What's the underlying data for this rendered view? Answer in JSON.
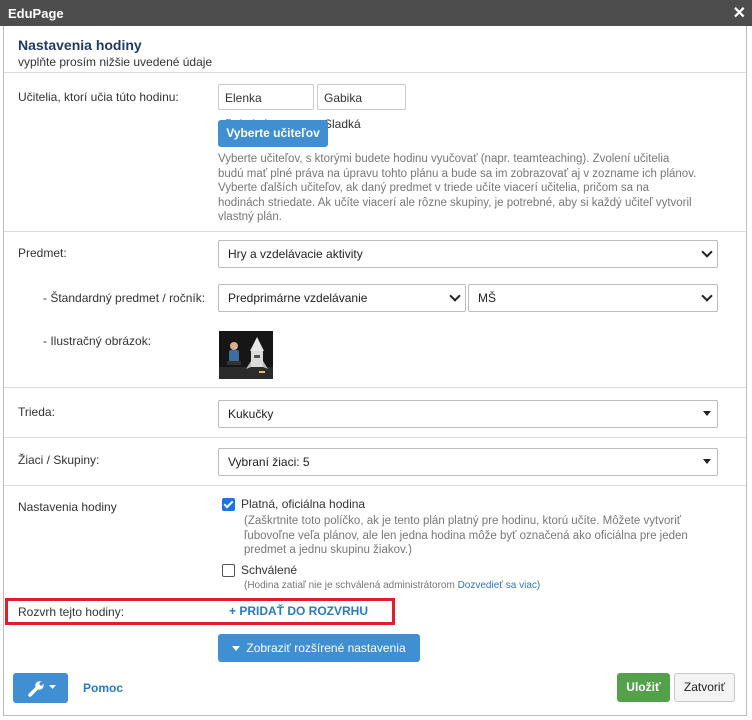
{
  "window": {
    "title": "EduPage",
    "close_icon": "close-icon"
  },
  "header": {
    "title": "Nastavenia hodiny",
    "subtitle": "vyplňte prosím nižšie uvedené údaje"
  },
  "teachers": {
    "label": "Učitelia, ktorí učia túto hodinu:",
    "selected": [
      "Elenka Pokojná",
      "Gabika Sladká"
    ],
    "button_label": "Vyberte učiteľov",
    "help_lines": [
      "Vyberte učiteľov, s ktorými budete hodinu vyučovať (napr. teamteaching). Zvolení učitelia",
      "budú mať plné práva na úpravu tohto plánu a bude sa im zobrazovať aj v zozname ich plánov.",
      "Vyberte ďalších učiteľov, ak daný predmet v triede učíte viacerí učitelia, pričom sa na",
      "hodinách striedate. Ak učíte viacerí ale rôzne skupiny, je potrebné, aby si každý učiteľ vytvoril",
      "vlastný plán."
    ]
  },
  "subject": {
    "label": "Predmet:",
    "value": "Hry a vzdelávacie aktivity"
  },
  "standard": {
    "label": "- Štandardný predmet / ročník:",
    "value1": "Predprimárne vzdelávanie",
    "value2": "MŠ"
  },
  "illustration": {
    "label": "- Ilustračný obrázok:"
  },
  "class": {
    "label": "Trieda:",
    "value": "Kukučky"
  },
  "students": {
    "label": "Žiaci / Skupiny:",
    "value": "Vybraní žiaci: 5"
  },
  "lesson_settings": {
    "label": "Nastavenia hodiny",
    "official": {
      "label": "Platná, oficiálna hodina",
      "checked": true,
      "note_lines": [
        "(Zaškrtnite toto políčko, ak je tento plán platný pre hodinu, ktorú učíte. Môžete vytvoriť",
        "ľubovoľne veľa plánov, ale len jedna hodina môže byť označená ako oficiálna pre jeden",
        "predmet a jednu skupinu žiakov.)"
      ]
    },
    "approved": {
      "label": "Schválené",
      "checked": false,
      "note": "(Hodina zatiaľ nie je schválená administrátorom",
      "link": "Dozvedieť sa viac)"
    }
  },
  "schedule": {
    "label": "Rozvrh tejto hodiny:",
    "add_link": "+ PRIDAŤ DO ROZVRHU"
  },
  "advanced_button": "Zobraziť rozšírené nastavenia",
  "footer": {
    "tools_icon": "wrench-icon",
    "help_link": "Pomoc",
    "save": "Uložiť",
    "close": "Zatvoriť"
  },
  "colors": {
    "titlebar": "#4d4d4d",
    "accent_blue": "#3f8fd2",
    "save_green": "#54a04b",
    "highlight_red": "#e01e28"
  }
}
